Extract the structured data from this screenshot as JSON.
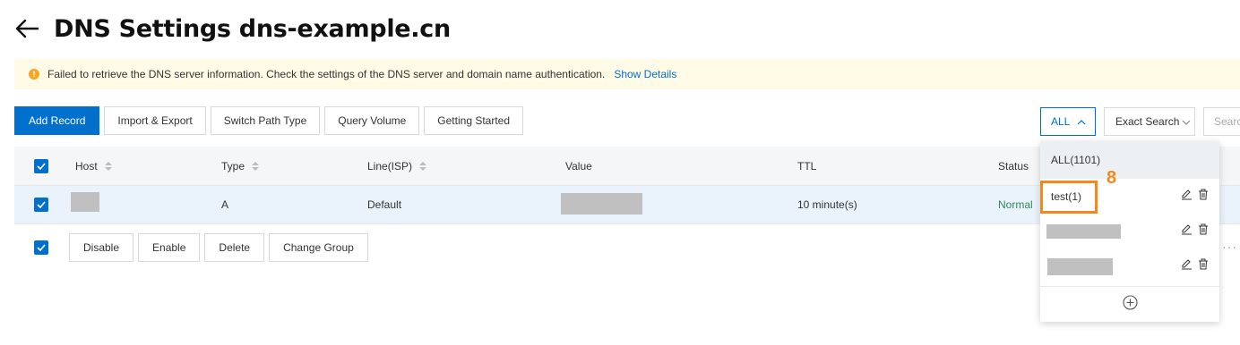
{
  "header": {
    "title": "DNS Settings dns-example.cn"
  },
  "alert": {
    "message": "Failed to retrieve the DNS server information. Check the settings of the DNS server and domain name authentication.",
    "link": "Show Details"
  },
  "toolbar": {
    "add_record": "Add Record",
    "import_export": "Import & Export",
    "switch_path_type": "Switch Path Type",
    "query_volume": "Query Volume",
    "getting_started": "Getting Started"
  },
  "filters": {
    "group_select": "ALL",
    "search_mode": "Exact Search",
    "search_placeholder": "Search"
  },
  "table": {
    "columns": [
      "Host",
      "Type",
      "Line(ISP)",
      "Value",
      "TTL",
      "Status"
    ],
    "rows": [
      {
        "host": "",
        "type": "A",
        "line": "Default",
        "value": "",
        "ttl": "10 minute(s)",
        "status": "Normal"
      }
    ]
  },
  "bulk_actions": {
    "disable": "Disable",
    "enable": "Enable",
    "delete": "Delete",
    "change_group": "Change Group"
  },
  "group_dropdown": {
    "all_option": "ALL(1101)",
    "items": [
      "test(1)",
      "",
      ""
    ]
  },
  "annotation": {
    "step": "8"
  },
  "colors": {
    "primary": "#0070cc",
    "highlight": "#f08a1c",
    "status_normal": "#2e8b57"
  }
}
